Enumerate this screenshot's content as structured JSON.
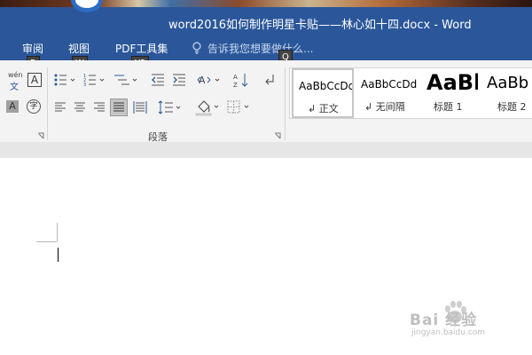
{
  "window": {
    "title": "word2016如何制作明星卡贴——林心如十四.docx - Word"
  },
  "tabs": [
    {
      "label": "审阅",
      "keytip": "R"
    },
    {
      "label": "视图",
      "keytip": "W"
    },
    {
      "label": "PDF工具集",
      "keytip": "Y2"
    }
  ],
  "tell_me": {
    "placeholder": "告诉我您想要做什么...",
    "keytip": "Q"
  },
  "ribbon": {
    "font_group": {
      "phonetic_guide_top": "wén",
      "phonetic_guide_bottom": "文",
      "char_border": "A",
      "char_shading": "A",
      "enclose_char": "字"
    },
    "paragraph_group": {
      "label": "段落"
    },
    "styles": [
      {
        "sample": "AaBbCcDd",
        "name": "正文",
        "selected": true
      },
      {
        "sample": "AaBbCcDd",
        "name": "无间隔",
        "selected": false
      },
      {
        "sample": "AaBb",
        "name": "标题 1",
        "selected": false
      },
      {
        "sample": "AaBb",
        "name": "标题 2",
        "selected": false
      }
    ]
  },
  "watermark": {
    "brand": "Bai 经验",
    "url": "jingyan.baidu.com"
  },
  "colors": {
    "title_bar": "#2b579a",
    "ribbon_bg": "#f3f3f3",
    "keytip_bg": "#444444"
  }
}
